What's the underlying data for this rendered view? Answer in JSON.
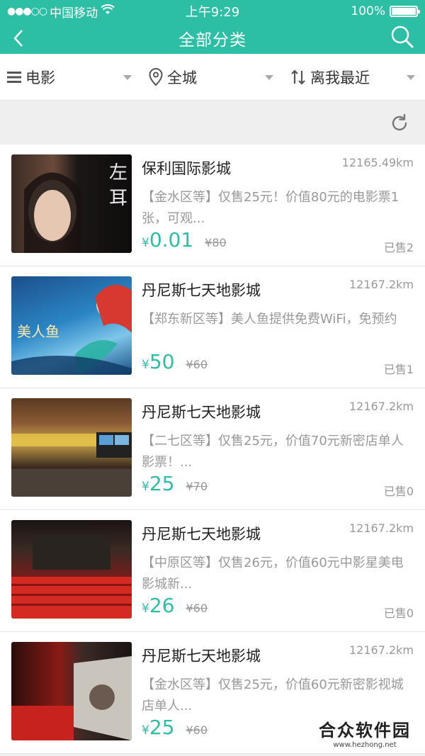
{
  "status_bar": {
    "signal": "●●●○○",
    "carrier": "中国移动",
    "time": "上午9:29",
    "battery": "100%"
  },
  "nav": {
    "title": "全部分类"
  },
  "filters": [
    {
      "label": "电影",
      "icon": "list-icon"
    },
    {
      "label": "全城",
      "icon": "location-pin-icon"
    },
    {
      "label": "离我最近",
      "icon": "sort-icon"
    }
  ],
  "items": [
    {
      "name": "保利国际影城",
      "distance": "12165.49km",
      "desc": "【金水区等】仅售25元！价值80元的电影票1张，可观...",
      "yen": "¥",
      "price": "0.01",
      "orig": "¥80",
      "sold": "已售2",
      "thumb_text": "左耳"
    },
    {
      "name": "丹尼斯七天地影城",
      "distance": "12167.2km",
      "desc": "【郑东新区等】美人鱼提供免费WiFi，免预约",
      "yen": "¥",
      "price": "50",
      "orig": "¥60",
      "sold": "已售1",
      "thumb_text": "美人鱼"
    },
    {
      "name": "丹尼斯七天地影城",
      "distance": "12167.2km",
      "desc": "【二七区等】仅售25元，价值70元新密店单人影票！...",
      "yen": "¥",
      "price": "25",
      "orig": "¥70",
      "sold": "已售0",
      "thumb_text": ""
    },
    {
      "name": "丹尼斯七天地影城",
      "distance": "12167.2km",
      "desc": "【中原区等】仅售26元，价值60元中影星美电影城新...",
      "yen": "¥",
      "price": "26",
      "orig": "¥60",
      "sold": "已售0",
      "thumb_text": ""
    },
    {
      "name": "丹尼斯七天地影城",
      "distance": "12167.2km",
      "desc": "【金水区等】仅售25元，价值60元新密影视城店单人...",
      "yen": "¥",
      "price": "25",
      "orig": "¥60",
      "sold": "",
      "thumb_text": ""
    }
  ],
  "watermark": {
    "main": "合众软件园",
    "sub": "www.hezhong.net"
  },
  "colors": {
    "accent": "#2dbfa5"
  }
}
